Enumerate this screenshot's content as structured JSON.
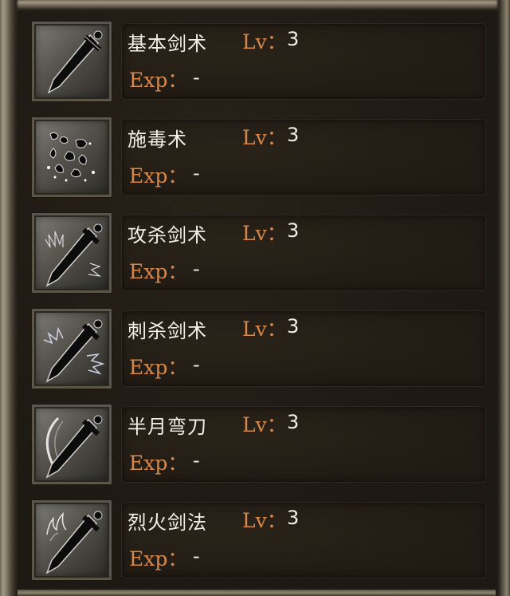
{
  "labels": {
    "lv": "Lv：",
    "exp": "Exp："
  },
  "skills": [
    {
      "name": "基本剑术",
      "level": "3",
      "exp": "-",
      "icon": "sword-icon"
    },
    {
      "name": "施毒术",
      "level": "3",
      "exp": "-",
      "icon": "poison-icon"
    },
    {
      "name": "攻杀剑术",
      "level": "3",
      "exp": "-",
      "icon": "flaming-sword-icon"
    },
    {
      "name": "刺杀剑术",
      "level": "3",
      "exp": "-",
      "icon": "spiked-sword-icon"
    },
    {
      "name": "半月弯刀",
      "level": "3",
      "exp": "-",
      "icon": "crescent-sword-icon"
    },
    {
      "name": "烈火剑法",
      "level": "3",
      "exp": "-",
      "icon": "fire-sword-icon"
    }
  ],
  "colors": {
    "label_orange": "#d9884a",
    "text_white": "#f2efe8",
    "panel_bg": "#211b14",
    "frame": "#8d846f"
  }
}
